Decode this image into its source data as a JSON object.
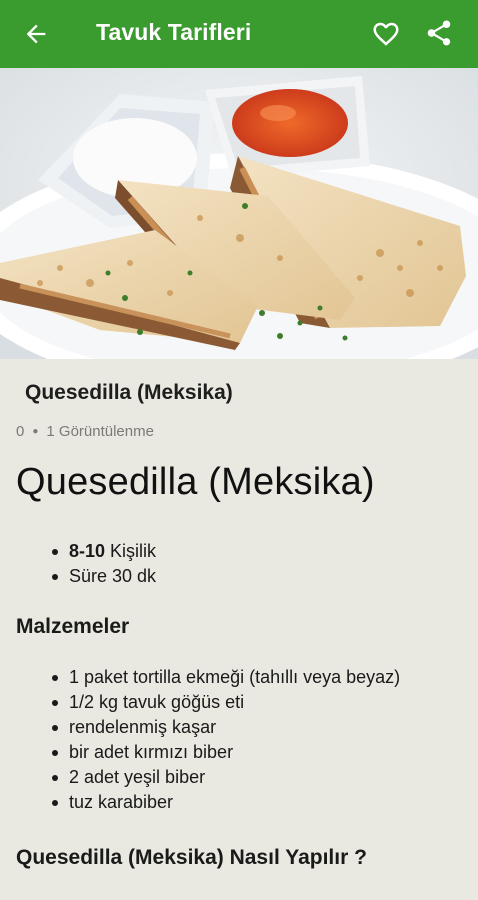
{
  "appbar": {
    "title": "Tavuk Tarifleri",
    "color": "#3a9b2e",
    "back_icon": "arrow-left-icon",
    "favorite_icon": "heart-outline-icon",
    "share_icon": "share-icon"
  },
  "hero": {
    "alt": "Quesedilla photo"
  },
  "recipe": {
    "subtitle": "Quesedilla (Meksika)",
    "likes": "0",
    "views": "1 Görüntülenme",
    "title": "Quesedilla (Meksika)",
    "info": [
      {
        "bold": "8-10",
        "text": " Kişilik"
      },
      {
        "bold": "",
        "text": "Süre 30 dk"
      }
    ],
    "ingredients_heading": "Malzemeler",
    "ingredients": [
      "1 paket tortilla ekmeği (tahıllı veya beyaz)",
      "1/2 kg tavuk göğüs eti",
      "rendelenmiş kaşar",
      "bir adet kırmızı biber",
      "2 adet yeşil biber",
      "tuz karabiber"
    ],
    "how_heading": "Quesedilla (Meksika) Nasıl Yapılır ?"
  }
}
